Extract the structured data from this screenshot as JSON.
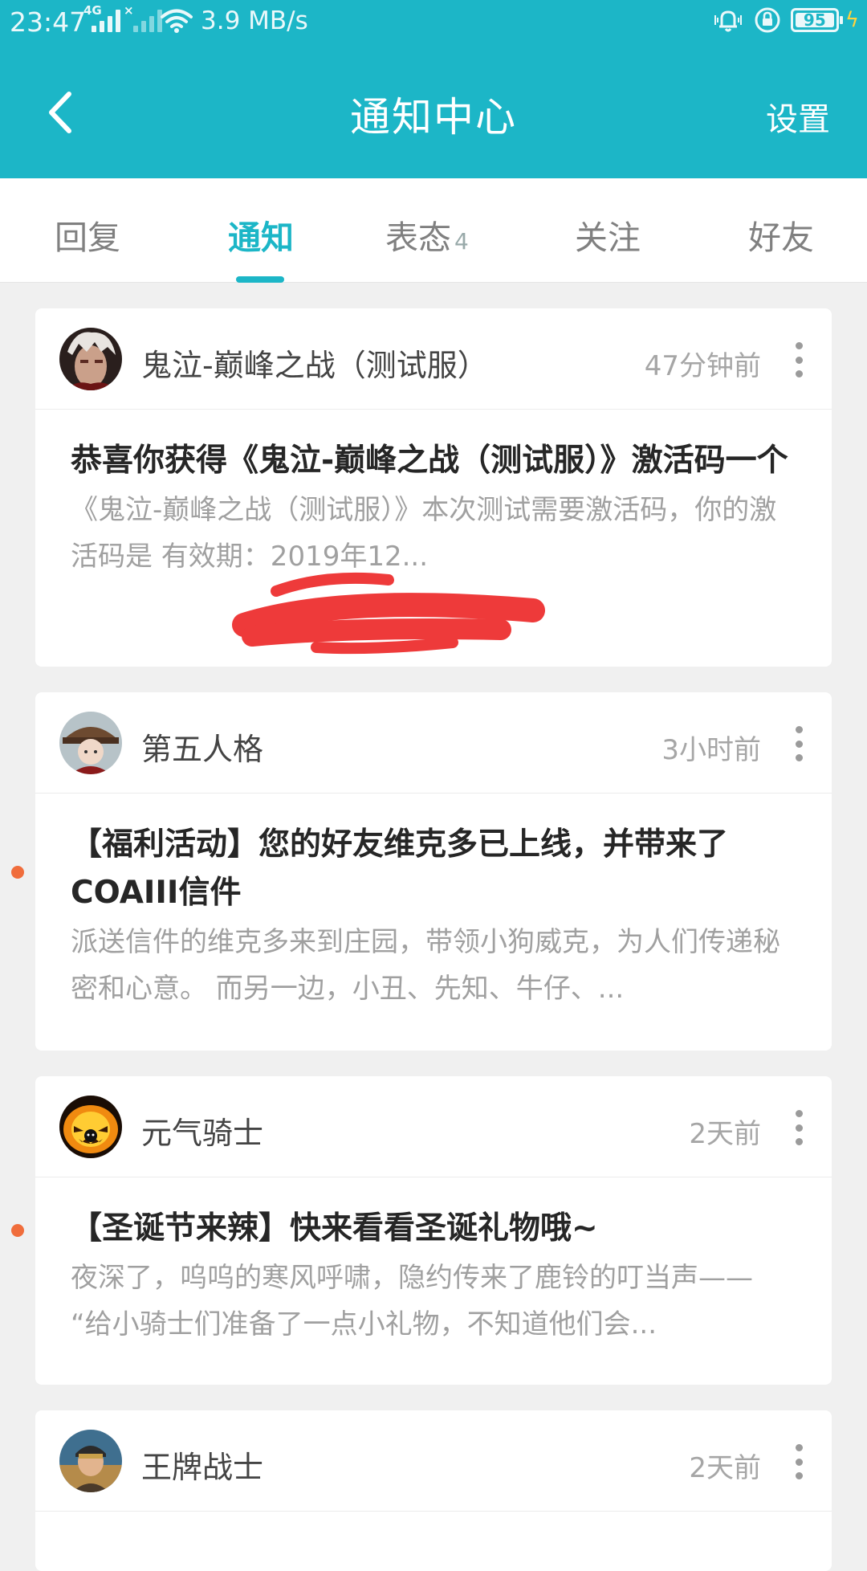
{
  "status_bar": {
    "time": "23:47",
    "network_type": "4G",
    "net_speed": "3.9 MB/s",
    "battery_level": "95"
  },
  "header": {
    "title": "通知中心",
    "settings_label": "设置"
  },
  "tabs": [
    {
      "label": "回复",
      "active": false
    },
    {
      "label": "通知",
      "active": true
    },
    {
      "label": "表态",
      "count": "4",
      "active": false
    },
    {
      "label": "关注",
      "active": false
    },
    {
      "label": "好友",
      "active": false
    }
  ],
  "notifications": [
    {
      "source": "鬼泣-巅峰之战（测试服）",
      "time": "47分钟前",
      "title": "恭喜你获得《鬼泣-巅峰之战（测试服）》激活码一个",
      "preview": "《鬼泣-巅峰之战（测试服）》本次测试需要激活码，你的激活码是                   有效期：2019年12...",
      "unread": false
    },
    {
      "source": "第五人格",
      "time": "3小时前",
      "title": "【福利活动】您的好友维克多已上线，并带来了COAIII信件",
      "preview": "派送信件的维克多来到庄园，带领小狗威克，为人们传递秘密和心意。 而另一边，小丑、先知、牛仔、...",
      "unread": true
    },
    {
      "source": "元气骑士",
      "time": "2天前",
      "title": "【圣诞节来辣】快来看看圣诞礼物哦~",
      "preview": "夜深了，呜呜的寒风呼啸，隐约传来了鹿铃的叮当声—— “给小骑士们准备了一点小礼物，不知道他们会...",
      "unread": true
    },
    {
      "source": "王牌战士",
      "time": "2天前",
      "unread": false
    }
  ],
  "colors": {
    "accent": "#1cb6c7",
    "unread_dot": "#f06d3c",
    "redaction": "#ee3a3a"
  }
}
